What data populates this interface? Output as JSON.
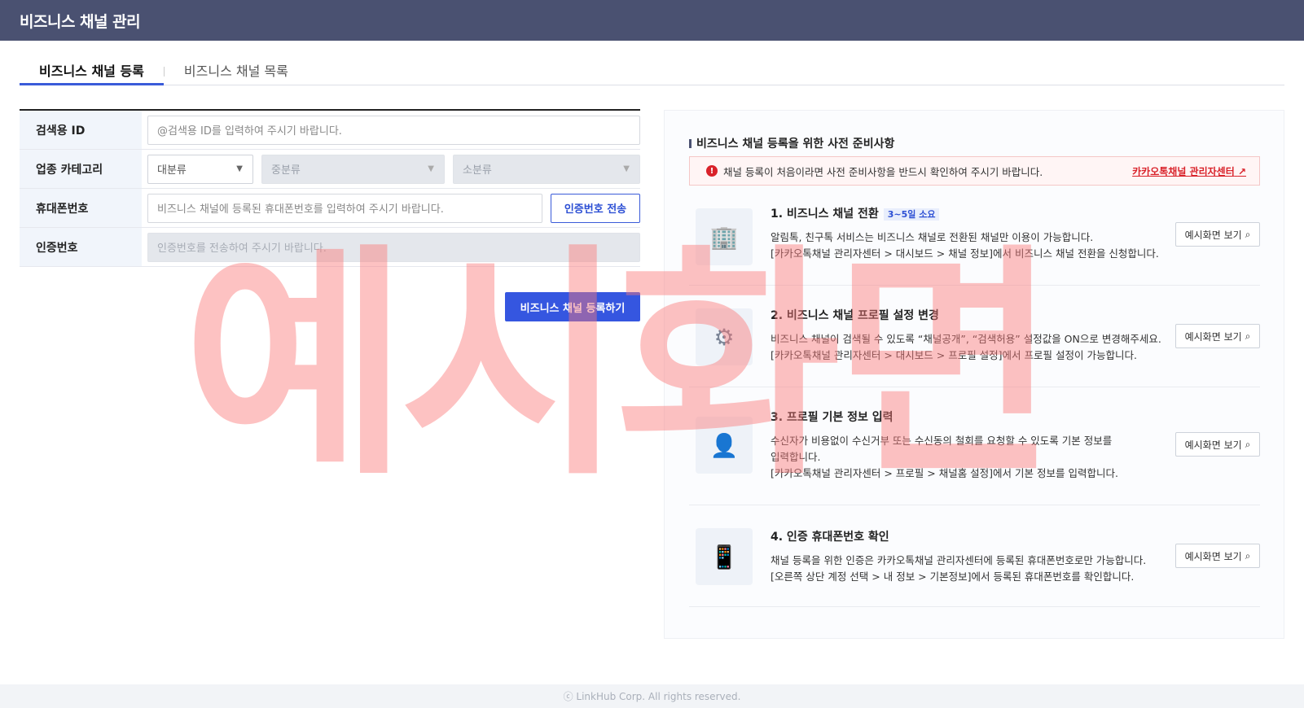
{
  "header": {
    "title": "비즈니스 채널 관리"
  },
  "tabs": [
    {
      "label": "비즈니스 채널 등록",
      "active": true
    },
    {
      "label": "비즈니스 채널 목록",
      "active": false
    }
  ],
  "form": {
    "search_id": {
      "label": "검색용 ID",
      "placeholder": "@검색용 ID를 입력하여 주시기 바랍니다."
    },
    "category": {
      "label": "업종 카테고리",
      "large": "대분류",
      "medium": "중분류",
      "small": "소분류"
    },
    "phone": {
      "label": "휴대폰번호",
      "placeholder": "비즈니스 채널에 등록된 휴대폰번호를 입력하여 주시기 바랍니다.",
      "send_button": "인증번호 전송"
    },
    "auth": {
      "label": "인증번호",
      "placeholder": "인증번호를 전송하여 주시기 바랍니다."
    },
    "submit": "비즈니스 채널 등록하기"
  },
  "guide": {
    "title": "비즈니스 채널 등록을 위한 사전 준비사항",
    "notice": "채널 등록이 처음이라면 사전 준비사항을 반드시 확인하여 주시기 바랍니다.",
    "notice_link": "카카오톡채널 관리자센터",
    "steps": [
      {
        "title": "1. 비즈니스 채널 전환",
        "badge": "3~5일 소요",
        "line1": "알림톡, 친구톡 서비스는 비즈니스 채널로 전환된 채널만 이용이 가능합니다.",
        "line2": "[카카오톡채널 관리자센터 > 대시보드 > 채널 정보]에서 비즈니스 채널 전환을 신청합니다.",
        "button": "예시화면 보기"
      },
      {
        "title": "2. 비즈니스 채널 프로필 설정 변경",
        "line1": "비즈니스 채널이 검색될 수 있도록 “채널공개”, “검색허용” 설정값을 ON으로 변경해주세요.",
        "line2": "[카카오톡채널 관리자센터 > 대시보드 > 프로필 설정]에서 프로필 설정이 가능합니다.",
        "button": "예시화면 보기"
      },
      {
        "title": "3. 프로필 기본 정보 입력",
        "line1": "수신자가 비용없이 수신거부 또는 수신동의 철회를 요청할 수 있도록 기본 정보를 입력합니다.",
        "line2": "[카카오톡채널 관리자센터 > 프로필 > 채널홈 설정]에서 기본 정보를 입력합니다.",
        "button": "예시화면 보기"
      },
      {
        "title": "4. 인증 휴대폰번호 확인",
        "line1": "채널 등록을 위한 인증은 카카오톡채널 관리자센터에 등록된 휴대폰번호로만 가능합니다.",
        "line2": "[오른쪽 상단 계정 선택 > 내 정보 > 기본정보]에서 등록된 휴대폰번호를 확인합니다.",
        "button": "예시화면 보기"
      }
    ]
  },
  "watermark": "예시화면",
  "footer": "ⓒ LinkHub Corp. All rights reserved.",
  "colors": {
    "header": "#4a5171",
    "primary": "#3556e0",
    "alert": "#d9222a"
  }
}
